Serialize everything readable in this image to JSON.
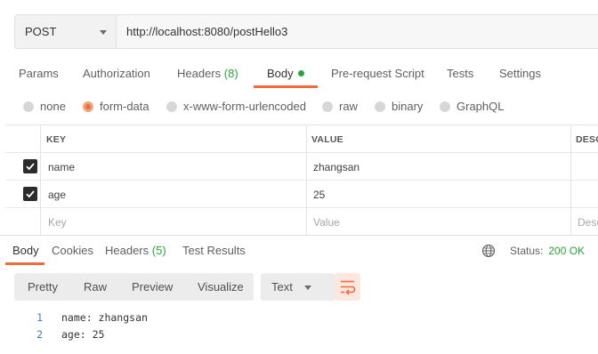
{
  "request": {
    "method": "POST",
    "url": "http://localhost:8080/postHello3"
  },
  "request_tabs": [
    {
      "label": "Params"
    },
    {
      "label": "Authorization"
    },
    {
      "label": "Headers",
      "count": "(8)"
    },
    {
      "label": "Body"
    },
    {
      "label": "Pre-request Script"
    },
    {
      "label": "Tests"
    },
    {
      "label": "Settings"
    }
  ],
  "active_request_tab": "Body",
  "body_types": [
    {
      "label": "none",
      "checked": false
    },
    {
      "label": "form-data",
      "checked": true
    },
    {
      "label": "x-www-form-urlencoded",
      "checked": false
    },
    {
      "label": "raw",
      "checked": false
    },
    {
      "label": "binary",
      "checked": false
    },
    {
      "label": "GraphQL",
      "checked": false
    }
  ],
  "params_table": {
    "headers": {
      "key": "KEY",
      "value": "VALUE",
      "description": "DESC"
    },
    "rows": [
      {
        "checked": true,
        "key": "name",
        "value": "zhangsan"
      },
      {
        "checked": true,
        "key": "age",
        "value": "25"
      }
    ],
    "placeholders": {
      "key": "Key",
      "value": "Value",
      "description": "Desc"
    }
  },
  "response_tabs": [
    {
      "label": "Body"
    },
    {
      "label": "Cookies"
    },
    {
      "label": "Headers",
      "count": "(5)"
    },
    {
      "label": "Test Results"
    }
  ],
  "active_response_tab": "Body",
  "response_status": {
    "label": "Status:",
    "value": "200 OK",
    "next": "T"
  },
  "view_modes": [
    "Pretty",
    "Raw",
    "Preview",
    "Visualize"
  ],
  "format": "Text",
  "response_body_lines": [
    {
      "num": "1",
      "text": "name: zhangsan"
    },
    {
      "num": "2",
      "text": "age: 25"
    }
  ],
  "colors": {
    "accent": "#f26b3a",
    "success": "#2aa53a",
    "line_number": "#3f7cbf"
  },
  "icons": {
    "globe": "globe-icon",
    "wrap": "wrap-lines-icon",
    "check": "check-icon"
  }
}
